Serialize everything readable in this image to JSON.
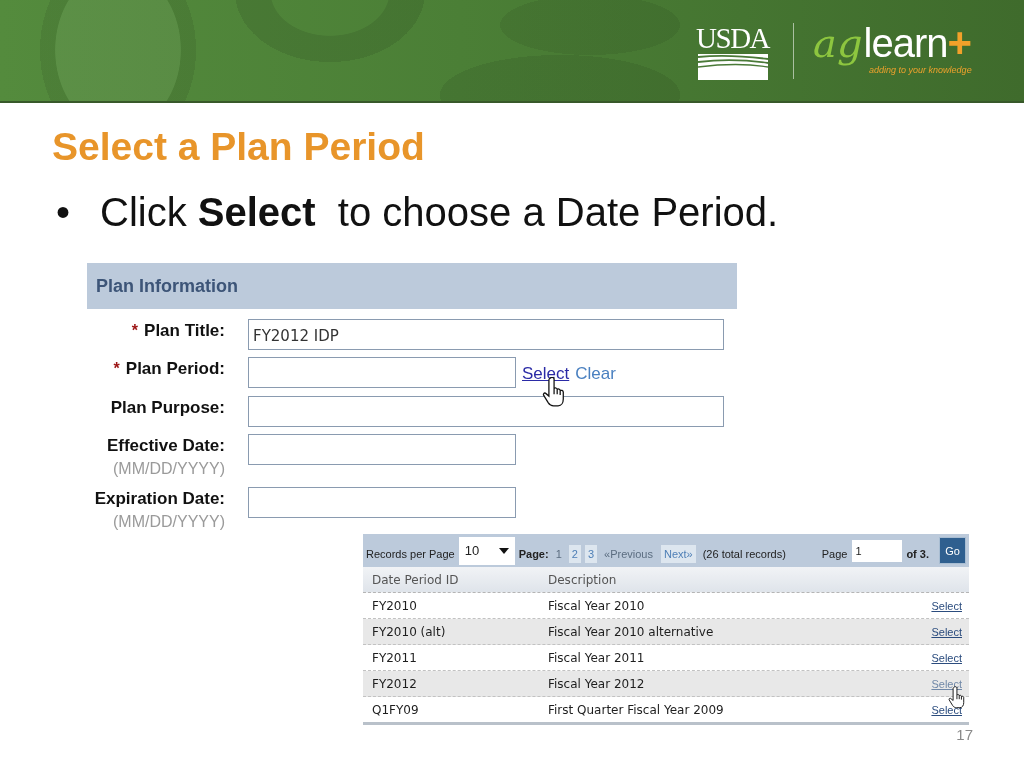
{
  "header": {
    "agency_logo": "USDA",
    "product_logo": {
      "accent": "ag",
      "name": "learn",
      "plus": "+",
      "tagline": "adding to your knowledge"
    }
  },
  "slide_title": "Select a Plan Period",
  "bullets": [
    {
      "marker": "•",
      "text": "Click **Select**  to choose a Date Period."
    }
  ],
  "plan_form": {
    "heading": "Plan Information",
    "fields": [
      {
        "kind": "text",
        "required_mark": "*",
        "label": "Plan Title:",
        "value": "FY2012 IDP"
      },
      {
        "kind": "lookup",
        "required_mark": "*",
        "label": "Plan Period:",
        "links": [
          {
            "label": "Select",
            "hovered": true
          },
          {
            "label": "Clear",
            "hovered": false
          }
        ]
      },
      {
        "kind": "text",
        "label": "Plan Purpose:"
      },
      {
        "kind": "date",
        "label": "Effective Date:",
        "hint": "(MM/DD/YYYY)"
      },
      {
        "kind": "date",
        "label": "Expiration Date:",
        "hint": "(MM/DD/YYYY)"
      }
    ]
  },
  "records_table": {
    "toolbar": {
      "records_label": "Records per Page",
      "per_page": "10",
      "pages_label": "Page:",
      "pages": [
        {
          "label": "1",
          "selected": true
        },
        {
          "label": "2",
          "selected": false
        },
        {
          "label": "3",
          "selected": false
        }
      ],
      "previous": {
        "label": "«Previous",
        "disabled": true
      },
      "next": {
        "label": "Next»",
        "disabled": false
      },
      "total": "(26 total records)",
      "goto_label": "Page",
      "goto_value": "1",
      "page_count": "of 3.",
      "go_button": "Go"
    },
    "columns": [
      "Date Period ID",
      "Description"
    ],
    "rows": [
      {
        "id": "FY2010",
        "description": "Fiscal Year 2010",
        "action": "Select",
        "hovered": false
      },
      {
        "id": "FY2010 (alt)",
        "description": "Fiscal Year 2010 alternative",
        "action": "Select",
        "hovered": false
      },
      {
        "id": "FY2011",
        "description": "Fiscal Year 2011",
        "action": "Select",
        "hovered": false
      },
      {
        "id": "FY2012",
        "description": "Fiscal Year 2012",
        "action": "Select",
        "hovered": true
      },
      {
        "id": "Q1FY09",
        "description": "First Quarter Fiscal Year 2009",
        "action": "Select",
        "hovered": false
      }
    ]
  },
  "page_number": "17"
}
